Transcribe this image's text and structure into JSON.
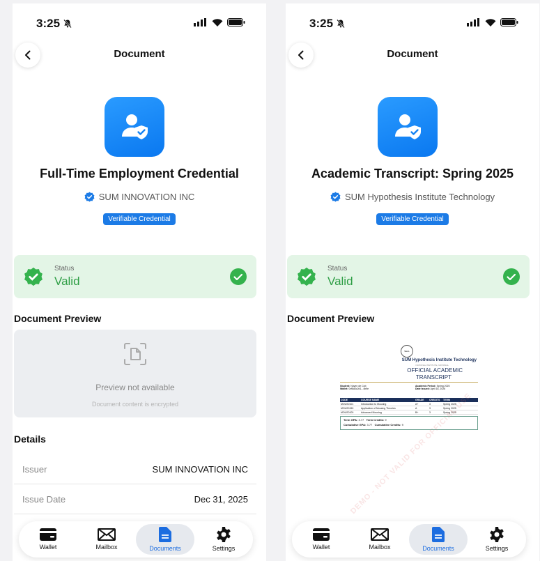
{
  "status_bar": {
    "time": "3:25"
  },
  "screens": [
    {
      "nav_title": "Document",
      "credential_title": "Full-Time Employment Credential",
      "issuer": "SUM INNOVATION INC",
      "badge": "Verifiable Credential",
      "status_label": "Status",
      "status_value": "Valid",
      "preview_heading": "Document Preview",
      "preview_title": "Preview not available",
      "preview_subtitle": "Document content is encrypted",
      "details_heading": "Details",
      "details": [
        {
          "key": "Issuer",
          "value": "SUM INNOVATION INC"
        },
        {
          "key": "Issue Date",
          "value": "Dec 31, 2025"
        }
      ]
    },
    {
      "nav_title": "Document",
      "credential_title": "Academic Transcript: Spring 2025",
      "issuer": "SUM Hypothesis Institute Technology",
      "badge": "Verifiable Credential",
      "status_label": "Status",
      "status_value": "Valid",
      "preview_heading": "Document Preview",
      "transcript": {
        "seal": "SEAL",
        "institution": "SUM Hypothesis Institute Technology",
        "subtitle": "NATIONAL INSTITUTE, NATIONAL",
        "title_line1": "OFFICIAL ACADEMIC",
        "title_line2": "TRANSCRIPT",
        "student_label": "Student:",
        "student_value": "Nuyen de Cob",
        "wallet_label": "Wallet:",
        "wallet_value": "0xf8a3c2d1...4b9e",
        "period_label": "Academic Period:",
        "period_value": "Spring 2025",
        "issued_label": "Date Issued:",
        "issued_value": "April 18, 2026",
        "headers": [
          "CODE",
          "COURSE NAME",
          "GRADE",
          "CREDITS",
          "TERM"
        ],
        "rows": [
          [
            "MOUS0101",
            "Introduction to Mousing",
            "A+",
            "3",
            "Spring 2025"
          ],
          [
            "MOUS0150",
            "Application of Mousing Theories",
            "A",
            "3",
            "Spring 2025"
          ],
          [
            "MOUS0100",
            "Advanced Mousing",
            "B+",
            "3",
            "Spring 2025"
          ]
        ],
        "term_gpa_label": "Term GPA:",
        "term_gpa": "3.77",
        "term_credits_label": "Term Credits:",
        "term_credits": "9",
        "cum_gpa_label": "Cumulative GPA:",
        "cum_gpa": "3.77",
        "cum_credits_label": "Cumulative Credits:",
        "cum_credits": "9",
        "watermark": "DEMO - NOT VALID FOR OFFICIAL USE"
      }
    }
  ],
  "tabs": [
    {
      "label": "Wallet",
      "icon": "wallet-icon"
    },
    {
      "label": "Mailbox",
      "icon": "mailbox-icon"
    },
    {
      "label": "Documents",
      "icon": "documents-icon",
      "active": true
    },
    {
      "label": "Settings",
      "icon": "settings-icon"
    }
  ],
  "colors": {
    "accent": "#1c7be6",
    "valid": "#2e9e45",
    "valid_bg": "#e3f5e6"
  }
}
